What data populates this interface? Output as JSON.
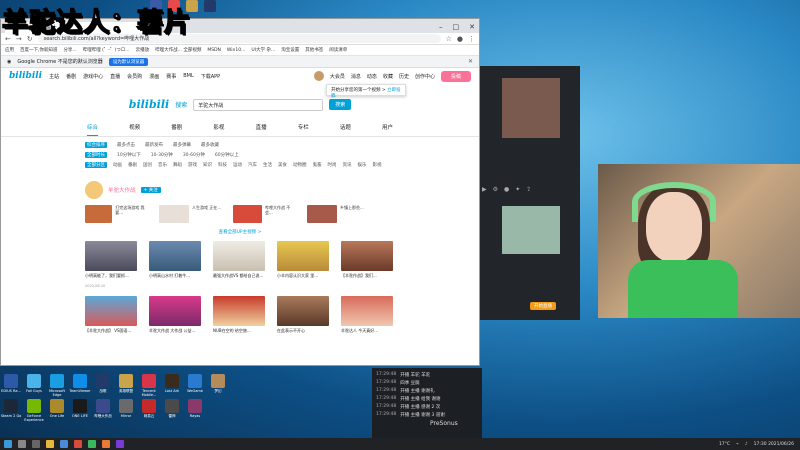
{
  "overlay_title": "羊驼达人：薯片",
  "browser": {
    "tab_title": "哔哩哔哩 - 羊驼大...",
    "url": "search.bilibili.com/all?keyword=哔哩大作战",
    "bookmarks": [
      "应用",
      "百度一下,你就知道",
      "分享...",
      "哔哩哔哩 (゜-゜)つロ...",
      "云播放",
      "哔哩大作战... 全部视频",
      "MSDN",
      "Win10...",
      "UI大学 杂...",
      "淘宝设置",
      "其他书签",
      "阅读清单"
    ],
    "infobar_text": "Google Chrome 不是您的默认浏览器",
    "infobar_button": "设为默认浏览器",
    "win_controls": [
      "–",
      "□",
      "✕"
    ]
  },
  "bili": {
    "logo": "bilibili",
    "nav": [
      "主站",
      "番剧",
      "游戏中心",
      "直播",
      "会员购",
      "漫画",
      "赛事",
      "BML",
      "下载APP"
    ],
    "nav_right": [
      "大会员",
      "消息",
      "动态",
      "收藏",
      "历史",
      "创作中心"
    ],
    "upload": "投稿",
    "popup_text": "开始分享您的第一个视频 >",
    "popup_link": "立即投稿",
    "search_label": "搜索",
    "search_value": "羊驼大作战",
    "search_button": "搜索",
    "cat_tabs": [
      {
        "label": "综合",
        "active": true
      },
      {
        "label": "视频",
        "active": false
      },
      {
        "label": "番剧",
        "active": false
      },
      {
        "label": "影视",
        "active": false
      },
      {
        "label": "直播",
        "active": false
      },
      {
        "label": "专栏",
        "active": false
      },
      {
        "label": "话题",
        "active": false
      },
      {
        "label": "用户",
        "active": false
      }
    ],
    "filter_rows": [
      [
        "综合排序",
        "最多点击",
        "最新发布",
        "最多弹幕",
        "最多收藏"
      ],
      [
        "全部时长",
        "10分钟以下",
        "10-30分钟",
        "30-60分钟",
        "60分钟以上"
      ],
      [
        "全部分区",
        "动画",
        "番剧",
        "国创",
        "音乐",
        "舞蹈",
        "游戏",
        "知识",
        "科技",
        "运动",
        "汽车",
        "生活",
        "美食",
        "动物圈",
        "鬼畜",
        "时尚",
        "资讯",
        "娱乐",
        "影视"
      ]
    ],
    "up_name": "羊驼大作战",
    "follow": "+ 关注",
    "up_videos": [
      {
        "title": "打完这场游戏 我要..."
      },
      {
        "title": "人生游戏 正在..."
      },
      {
        "title": "哔哩大作战 不会..."
      },
      {
        "title": "乡镇上那些..."
      }
    ],
    "more_link": "查看全部UP主视频 >",
    "videos": [
      {
        "title": "小明高能了，我们要抓...",
        "meta": "2020-08-10"
      },
      {
        "title": "小明高山水村 打着牛..."
      },
      {
        "title": "最强大作战VS 都给自己说..."
      },
      {
        "title": "小羊内容认识大家 里..."
      },
      {
        "title": "【羊驼作战】我们..."
      },
      {
        "title": "【羊驼大作战】 VS国语..."
      },
      {
        "title": "羊驼大作战 大作战 公益..."
      },
      {
        "title": "NUB在空的 给空旅..."
      },
      {
        "title": "在此表示不开心"
      },
      {
        "title": "羊驼达人 今天真好..."
      }
    ]
  },
  "chat": [
    {
      "t": "17:29:48",
      "msg": "开播 羊驼 羊驼"
    },
    {
      "t": "17:29:48",
      "msg": "四季 豆腐"
    },
    {
      "t": "17:29:48",
      "msg": "开播 主播 谢谢礼"
    },
    {
      "t": "17:29:48",
      "msg": "开播 主播 给我 谢谢"
    },
    {
      "t": "17:29:48",
      "msg": "开播 主播 感谢 2 次"
    },
    {
      "t": "17:29:48",
      "msg": "开播 主播 谢谢 3 道谢"
    }
  ],
  "presonus": "PreSonus",
  "obs_live": "开始直播",
  "desktop_icons": [
    {
      "label": "EDIUS Ra...",
      "color": "#2d5aa8"
    },
    {
      "label": "Fall Guys",
      "color": "#4ab3e8"
    },
    {
      "label": "Microsoft Edge",
      "color": "#1b9de2"
    },
    {
      "label": "TeamViewer",
      "color": "#0e8ee9"
    },
    {
      "label": "战歌",
      "color": "#223a6a"
    },
    {
      "label": "英雄联盟",
      "color": "#c9a44a"
    },
    {
      "label": "Tencent Mobile...",
      "color": "#d9354a"
    },
    {
      "label": "Lost Ark",
      "color": "#3a2c1c"
    },
    {
      "label": "WeGame",
      "color": "#2a7ad0"
    },
    {
      "label": "梦幻",
      "color": "#b68b5a"
    },
    {
      "label": "Steam 2 Go",
      "color": "#1b2838"
    },
    {
      "label": "GeForce Experience",
      "color": "#76b900"
    },
    {
      "label": "One Life",
      "color": "#aa8a2a"
    },
    {
      "label": "ONE LIFE",
      "color": "#1a1a1a"
    },
    {
      "label": "哔哩大作战",
      "color": "#3a4a8a"
    },
    {
      "label": "Mirror",
      "color": "#6a6a6a"
    },
    {
      "label": "网易云",
      "color": "#c52a2a"
    },
    {
      "label": "雷神",
      "color": "#4a4a4a"
    },
    {
      "label": "Rayas",
      "color": "#8a3a6a"
    }
  ],
  "taskbar": {
    "temp": "17°C",
    "time": "17:30",
    "date": "2021/06/26"
  }
}
